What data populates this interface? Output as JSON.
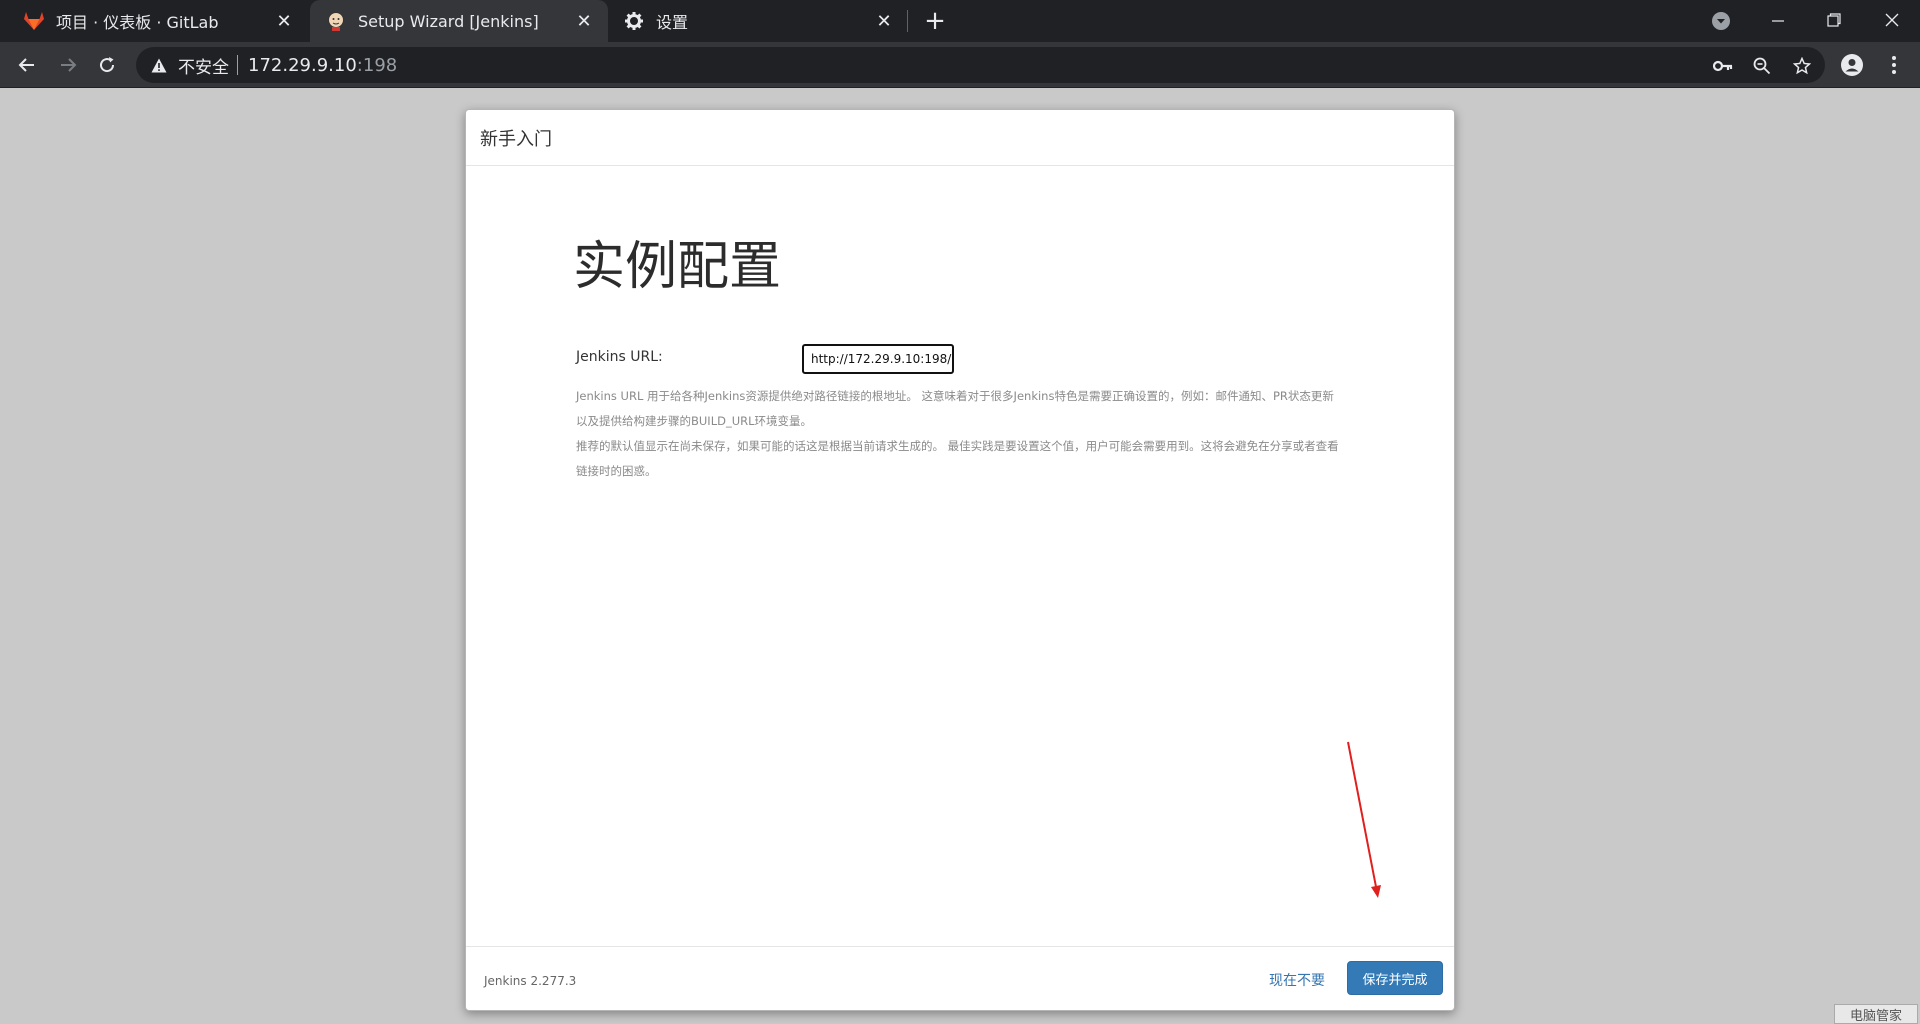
{
  "browser": {
    "tabs": [
      {
        "title": "项目 · 仪表板 · GitLab",
        "icon": "gitlab-icon",
        "active": false
      },
      {
        "title": "Setup Wizard [Jenkins]",
        "icon": "jenkins-icon",
        "active": true
      },
      {
        "title": "设置",
        "icon": "gear-icon",
        "active": false
      }
    ],
    "address": {
      "security_text": "不安全",
      "host": "172.29.9.10",
      "port": ":198"
    }
  },
  "dialog": {
    "header_title": "新手入门",
    "page_title": "实例配置",
    "jenkins_url_label": "Jenkins URL:",
    "jenkins_url_value": "http://172.29.9.10:198/",
    "help_paragraph_1": "Jenkins URL 用于给各种Jenkins资源提供绝对路径链接的根地址。 这意味着对于很多Jenkins特色是需要正确设置的，例如：邮件通知、PR状态更新以及提供给构建步骤的BUILD_URL环境变量。",
    "help_paragraph_2": "推荐的默认值显示在尚未保存，如果可能的话这是根据当前请求生成的。 最佳实践是要设置这个值，用户可能会需要用到。这将会避免在分享或者查看链接时的困惑。",
    "version": "Jenkins 2.277.3",
    "skip_label": "现在不要",
    "save_label": "保存并完成"
  },
  "watermark": "电脑管家",
  "colors": {
    "primary_button": "#337ab7",
    "link": "#3676b0",
    "annotation_arrow": "#e0201e"
  }
}
